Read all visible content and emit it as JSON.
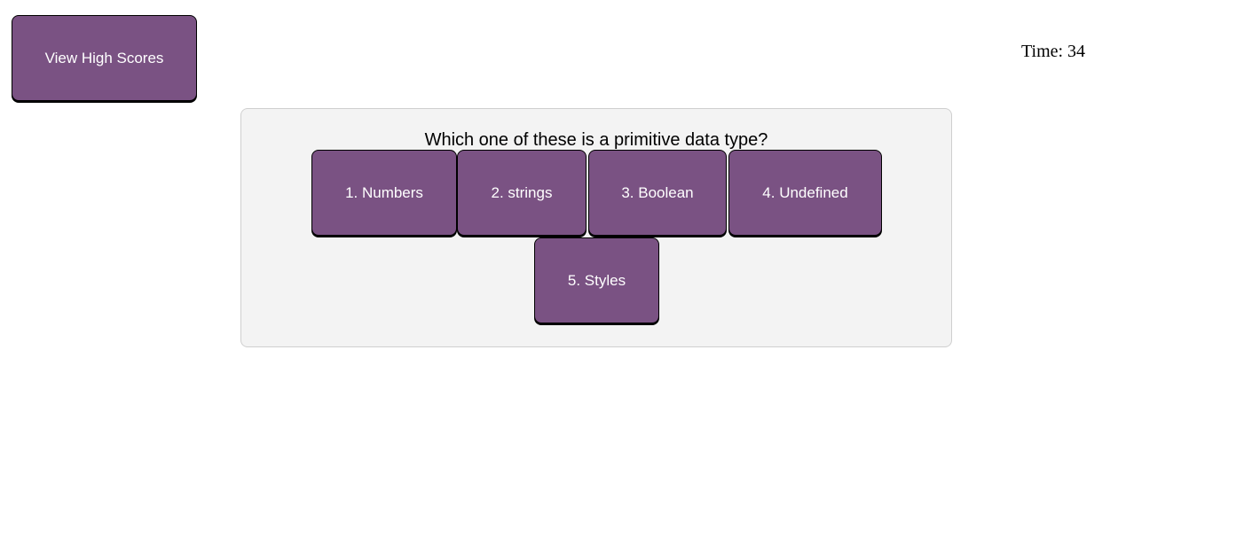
{
  "header": {
    "high_scores_label": "View High Scores",
    "timer_text": "Time: 34"
  },
  "quiz": {
    "question": "Which one of these is a primitive data type?",
    "choices": [
      {
        "label": "1. Numbers"
      },
      {
        "label": "2. strings"
      },
      {
        "label": "3. Boolean"
      },
      {
        "label": "4. Undefined"
      },
      {
        "label": "5. Styles"
      }
    ]
  },
  "colors": {
    "button_bg": "#7a5283",
    "button_text": "#ffffff",
    "card_bg": "#f3f3f3",
    "card_border": "#cfcfcf"
  }
}
